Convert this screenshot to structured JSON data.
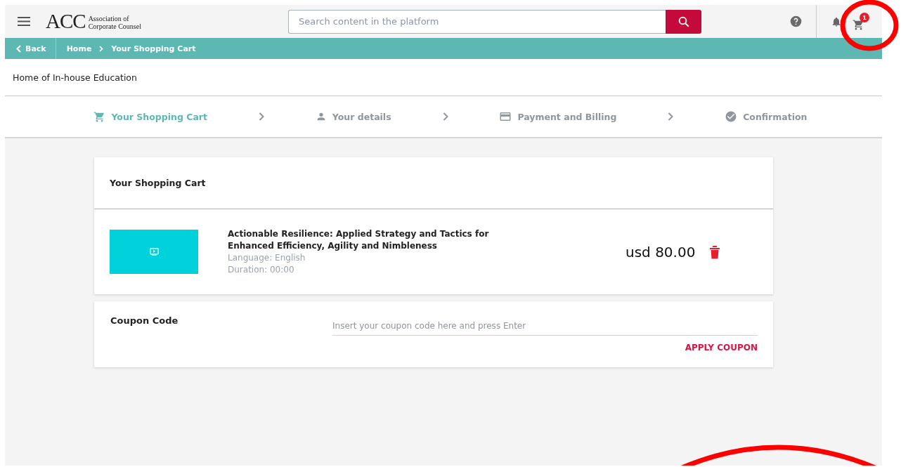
{
  "header": {
    "logo": {
      "mark": "ACC",
      "name_line_1": "Association of",
      "name_line_2": "Corporate Counsel"
    },
    "search": {
      "placeholder": "Search content in the platform"
    },
    "cart_badge": "1"
  },
  "breadcrumb": {
    "back": "Back",
    "items": [
      "Home",
      "Your Shopping Cart"
    ]
  },
  "tagline": "Home of In-house Education",
  "steps": [
    {
      "kind": "cart",
      "label": "Your Shopping Cart",
      "selected": true
    },
    {
      "kind": "person",
      "label": "Your details",
      "selected": false
    },
    {
      "kind": "card",
      "label": "Payment and Billing",
      "selected": false
    },
    {
      "kind": "check",
      "label": "Confirmation",
      "selected": false
    }
  ],
  "cart": {
    "title": "Your Shopping Cart",
    "items": [
      {
        "title_line_1": "Actionable Resilience: Applied Strategy and Tactics for",
        "title_line_2": "Enhanced Efficiency, Agility and Nimbleness",
        "language": "Language: English",
        "duration": "Duration: 00:00",
        "price": "usd 80.00"
      }
    ]
  },
  "coupon": {
    "title": "Coupon Code",
    "placeholder": "Insert your coupon code here and press Enter",
    "button": "APPLY COUPON"
  }
}
